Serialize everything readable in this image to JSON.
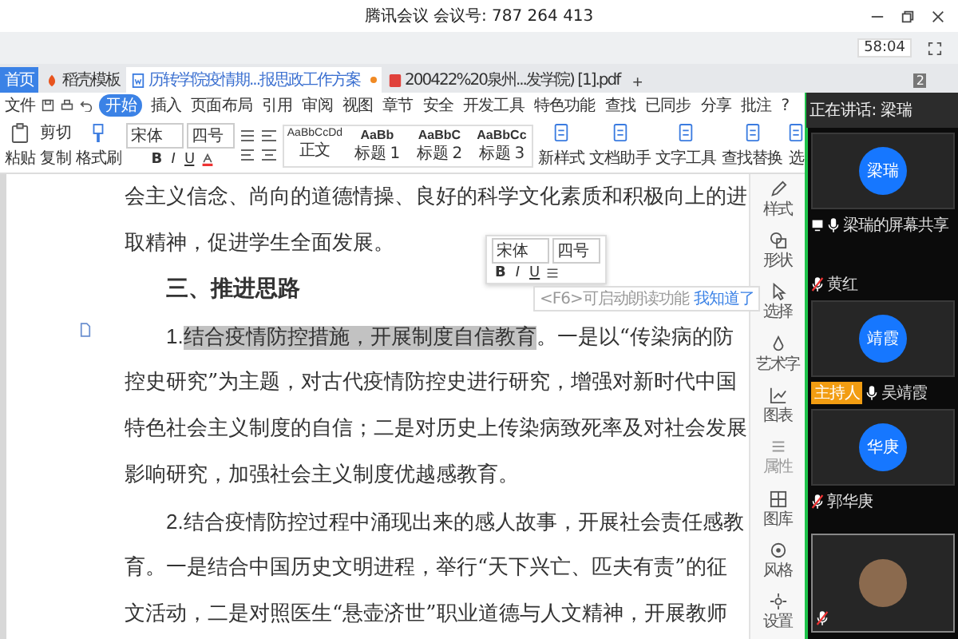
{
  "meeting_bar": {
    "title": "腾讯会议 会议号: 787 264 413",
    "timer": "58:04"
  },
  "tabs": [
    {
      "label": "首页",
      "kind": "home",
      "selected": false
    },
    {
      "label": "稻壳模板",
      "kind": "template",
      "selected": false
    },
    {
      "label": "历转学院疫情期...报思政工作方案",
      "kind": "doc",
      "selected": true
    },
    {
      "label": "200422%20泉州...发学院) [1].pdf",
      "kind": "pdf",
      "selected": false
    }
  ],
  "new_tab": "+",
  "badge": "2",
  "menu": {
    "file": "文件",
    "items": [
      {
        "label": "开始",
        "selected": true
      },
      {
        "label": "插入",
        "selected": false
      },
      {
        "label": "页面布局",
        "selected": false
      },
      {
        "label": "引用",
        "selected": false
      },
      {
        "label": "审阅",
        "selected": false
      },
      {
        "label": "视图",
        "selected": false
      },
      {
        "label": "章节",
        "selected": false
      },
      {
        "label": "安全",
        "selected": false
      },
      {
        "label": "开发工具",
        "selected": false
      },
      {
        "label": "特色功能",
        "selected": false
      }
    ],
    "search": "查找",
    "actions": [
      "已同步",
      "分享",
      "批注"
    ],
    "help": "?"
  },
  "toolbar": {
    "paste": "粘贴",
    "cut": "剪切",
    "copy": "复制",
    "format_painter": "格式刷",
    "font": "宋体",
    "size": "四号",
    "format": [
      "B",
      "I",
      "U"
    ],
    "styles": [
      {
        "sample": "AaBbCcDd",
        "name": "正文"
      },
      {
        "sample": "AaBb",
        "name": "标题 1"
      },
      {
        "sample": "AaBbC",
        "name": "标题 2"
      },
      {
        "sample": "AaBbCc",
        "name": "标题 3"
      }
    ],
    "tools": [
      "新样式",
      "文档助手",
      "文字工具",
      "查找替换",
      "选"
    ]
  },
  "document": {
    "lines": [
      {
        "kind": "plain",
        "text": "会主义信念、尚向的道德情操、良好的科学文化素质和积极向上的进"
      },
      {
        "kind": "plain",
        "text": "取精神，促进学生全面发展。"
      },
      {
        "kind": "heading",
        "text": "三、推进思路"
      },
      {
        "kind": "item",
        "lead": "1.",
        "highlight": "结合疫情防控措施，开展制度自信教育",
        "text": "。一是以“传染病的防"
      },
      {
        "kind": "plain",
        "text": "控史研究”为主题，对古代疫情防控史进行研究，增强对新时代中国"
      },
      {
        "kind": "plain",
        "text": "特色社会主义制度的自信；二是对历史上传染病致死率及对社会发展"
      },
      {
        "kind": "plain",
        "text": "影响研究，加强社会主义制度优越感教育。"
      },
      {
        "kind": "item",
        "lead": "2.",
        "text": "结合疫情防控过程中涌现出来的感人故事，开展社会责任感教"
      },
      {
        "kind": "plain",
        "text": "育。一是结合中国历史文明进程，举行“天下兴亡、匹夫有责”的征"
      },
      {
        "kind": "plain",
        "text": "文活动，二是对照医生“悬壶济世”职业道德与人文精神，开展教师"
      }
    ],
    "mini_toolbar": {
      "font": "宋体",
      "size": "四号",
      "format": [
        "B",
        "I",
        "U"
      ]
    },
    "tip": {
      "text": "<F6>可启动朗读功能",
      "link": "我知道了"
    }
  },
  "sidebar": [
    {
      "kind": "pen",
      "label": "样式",
      "disabled": false
    },
    {
      "kind": "shape",
      "label": "形状",
      "disabled": false
    },
    {
      "kind": "cursor",
      "label": "选择",
      "disabled": false
    },
    {
      "kind": "paint",
      "label": "艺术字",
      "disabled": false
    },
    {
      "kind": "chart",
      "label": "图表",
      "disabled": false
    },
    {
      "kind": "props",
      "label": "属性",
      "disabled": true
    },
    {
      "kind": "gallery",
      "label": "图库",
      "disabled": false
    },
    {
      "kind": "style",
      "label": "风格",
      "disabled": false
    },
    {
      "kind": "settings",
      "label": "设置",
      "disabled": false
    }
  ],
  "meeting": {
    "speaking": "正在讲话: 梁瑞",
    "participants": [
      {
        "kind": "tile",
        "avatar": "梁瑞",
        "name": "梁瑞的屏幕共享",
        "sharing": true,
        "muted": false
      },
      {
        "kind": "audio",
        "name": "黄红",
        "muted": true
      },
      {
        "kind": "tile",
        "avatar": "靖霞",
        "host": "主持人",
        "name": "吴靖霞",
        "sharing": false,
        "muted": false
      },
      {
        "kind": "tile",
        "avatar": "华庚",
        "name": "郭华庚",
        "sharing": false,
        "muted": true
      },
      {
        "kind": "photo",
        "muted": true
      }
    ]
  }
}
